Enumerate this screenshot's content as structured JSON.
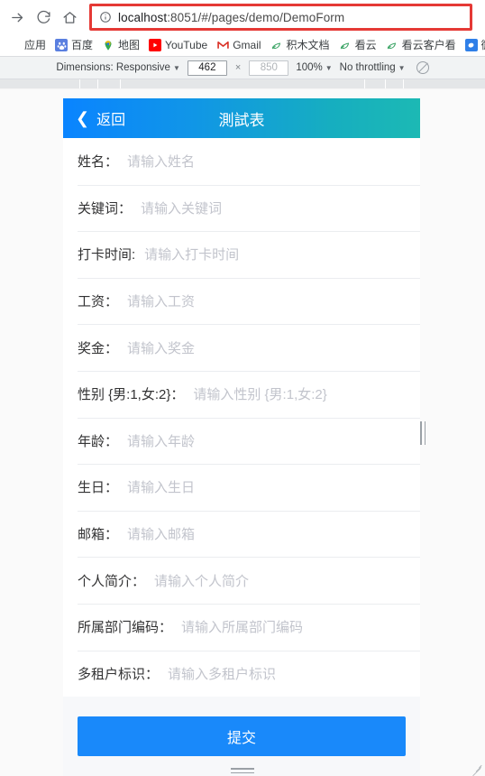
{
  "browser": {
    "nav": {
      "forward_label": "Forward",
      "reload_label": "Reload",
      "home_label": "Home"
    },
    "omnibox": {
      "info_icon": "info-circle-icon",
      "host": "localhost",
      "path": ":8051/#/pages/demo/DemoForm",
      "full_url": "localhost:8051/#/pages/demo/DemoForm",
      "highlight_color": "#e53935"
    },
    "bookmarks": [
      {
        "label": "应用",
        "icon": "apps-grid-icon",
        "icon_class": "ico-apps",
        "glyph": ""
      },
      {
        "label": "百度",
        "icon": "baidu-paw-icon",
        "icon_class": "ico-baidu",
        "glyph": "熊"
      },
      {
        "label": "地图",
        "icon": "map-pin-icon",
        "icon_class": "ico-maps",
        "glyph": "📍"
      },
      {
        "label": "YouTube",
        "icon": "youtube-icon",
        "icon_class": "ico-yt",
        "glyph": "▶"
      },
      {
        "label": "Gmail",
        "icon": "gmail-icon",
        "icon_class": "ico-gmail",
        "glyph": "M"
      },
      {
        "label": "积木文档",
        "icon": "leaf-icon",
        "icon_class": "ico-leaf",
        "glyph": "❧"
      },
      {
        "label": "看云",
        "icon": "leaf-icon",
        "icon_class": "ico-leaf",
        "glyph": "❧"
      },
      {
        "label": "看云客户看",
        "icon": "leaf-icon",
        "icon_class": "ico-leaf",
        "glyph": "❧"
      },
      {
        "label": "微服",
        "icon": "blue-square-icon",
        "icon_class": "ico-blue",
        "glyph": "🗨"
      }
    ]
  },
  "device_toolbar": {
    "dimensions_label": "Dimensions: Responsive",
    "width_value": "462",
    "height_value": "850",
    "height_is_placeholder": true,
    "multiply_symbol": "×",
    "zoom_label": "100%",
    "throttling_label": "No throttling",
    "throttle_icon": "network-offline-icon"
  },
  "app": {
    "header": {
      "back_icon": "chevron-left-icon",
      "back_label": "返回",
      "title": "測試表",
      "gradient_from": "#0a84ff",
      "gradient_to": "#1cb9b4"
    },
    "fields": [
      {
        "label": "姓名：",
        "placeholder": "请输入姓名"
      },
      {
        "label": "关键词：",
        "placeholder": "请输入关键词"
      },
      {
        "label": "打卡时间:",
        "placeholder": "请输入打卡时间"
      },
      {
        "label": "工资：",
        "placeholder": "请输入工资"
      },
      {
        "label": "奖金：",
        "placeholder": "请输入奖金"
      },
      {
        "label": "性别 {男:1,女:2}：",
        "placeholder": "请输入性别 {男:1,女:2}"
      },
      {
        "label": "年龄：",
        "placeholder": "请输入年龄"
      },
      {
        "label": "生日：",
        "placeholder": "请输入生日"
      },
      {
        "label": "邮箱：",
        "placeholder": "请输入邮箱"
      },
      {
        "label": "个人简介：",
        "placeholder": "请输入个人简介"
      },
      {
        "label": "所属部门编码：",
        "placeholder": "请输入所属部门编码"
      },
      {
        "label": "多租户标识：",
        "placeholder": "请输入多租户标识"
      }
    ],
    "submit": {
      "label": "提交",
      "color": "#1989fa"
    }
  }
}
